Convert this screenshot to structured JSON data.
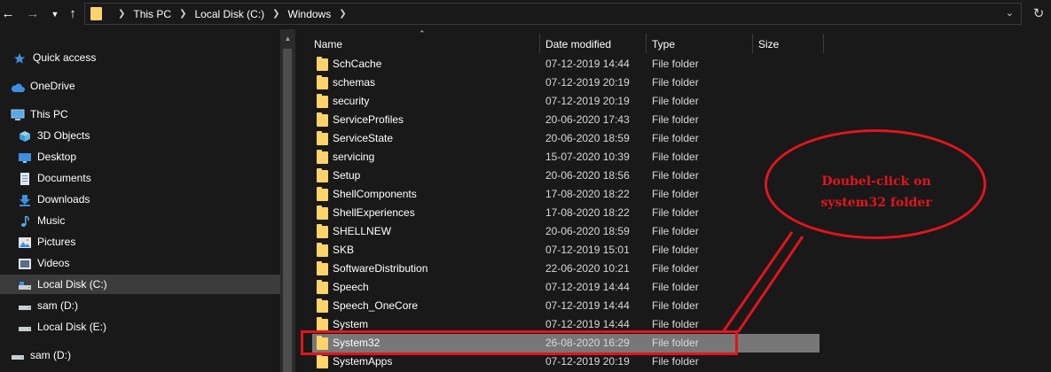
{
  "breadcrumbs": [
    "This PC",
    "Local Disk (C:)",
    "Windows"
  ],
  "nav": {
    "items": [
      {
        "label": "Quick access",
        "icon": "star-icon"
      },
      {
        "label": "OneDrive",
        "icon": "cloud-icon"
      },
      {
        "label": "This PC",
        "icon": "computer-icon"
      },
      {
        "label": "3D Objects",
        "icon": "cube-icon"
      },
      {
        "label": "Desktop",
        "icon": "desktop-icon"
      },
      {
        "label": "Documents",
        "icon": "document-icon"
      },
      {
        "label": "Downloads",
        "icon": "download-icon"
      },
      {
        "label": "Music",
        "icon": "music-icon"
      },
      {
        "label": "Pictures",
        "icon": "pictures-icon"
      },
      {
        "label": "Videos",
        "icon": "videos-icon"
      },
      {
        "label": "Local Disk (C:)",
        "icon": "drive-icon",
        "selected": true
      },
      {
        "label": "sam (D:)",
        "icon": "drive-icon"
      },
      {
        "label": "Local Disk (E:)",
        "icon": "drive-icon"
      },
      {
        "label": "sam (D:)",
        "icon": "drive-icon"
      }
    ]
  },
  "columns": {
    "name": "Name",
    "date": "Date modified",
    "type": "Type",
    "size": "Size"
  },
  "rows": [
    {
      "name": "SchCache",
      "date": "07-12-2019 14:44",
      "type": "File folder"
    },
    {
      "name": "schemas",
      "date": "07-12-2019 20:19",
      "type": "File folder"
    },
    {
      "name": "security",
      "date": "07-12-2019 20:19",
      "type": "File folder"
    },
    {
      "name": "ServiceProfiles",
      "date": "20-06-2020 17:43",
      "type": "File folder"
    },
    {
      "name": "ServiceState",
      "date": "20-06-2020 18:59",
      "type": "File folder"
    },
    {
      "name": "servicing",
      "date": "15-07-2020 10:39",
      "type": "File folder"
    },
    {
      "name": "Setup",
      "date": "20-06-2020 18:56",
      "type": "File folder"
    },
    {
      "name": "ShellComponents",
      "date": "17-08-2020 18:22",
      "type": "File folder"
    },
    {
      "name": "ShellExperiences",
      "date": "17-08-2020 18:22",
      "type": "File folder"
    },
    {
      "name": "SHELLNEW",
      "date": "20-06-2020 18:59",
      "type": "File folder"
    },
    {
      "name": "SKB",
      "date": "07-12-2019 15:01",
      "type": "File folder"
    },
    {
      "name": "SoftwareDistribution",
      "date": "22-06-2020 10:21",
      "type": "File folder"
    },
    {
      "name": "Speech",
      "date": "07-12-2019 14:44",
      "type": "File folder"
    },
    {
      "name": "Speech_OneCore",
      "date": "07-12-2019 14:44",
      "type": "File folder"
    },
    {
      "name": "System",
      "date": "07-12-2019 14:44",
      "type": "File folder"
    },
    {
      "name": "System32",
      "date": "26-08-2020 16:29",
      "type": "File folder",
      "selected": true
    },
    {
      "name": "SystemApps",
      "date": "07-12-2019 20:19",
      "type": "File folder"
    }
  ],
  "annotation": {
    "line1": "Doubel-click on",
    "line2": "system32 folder",
    "color": "#e3141d"
  }
}
